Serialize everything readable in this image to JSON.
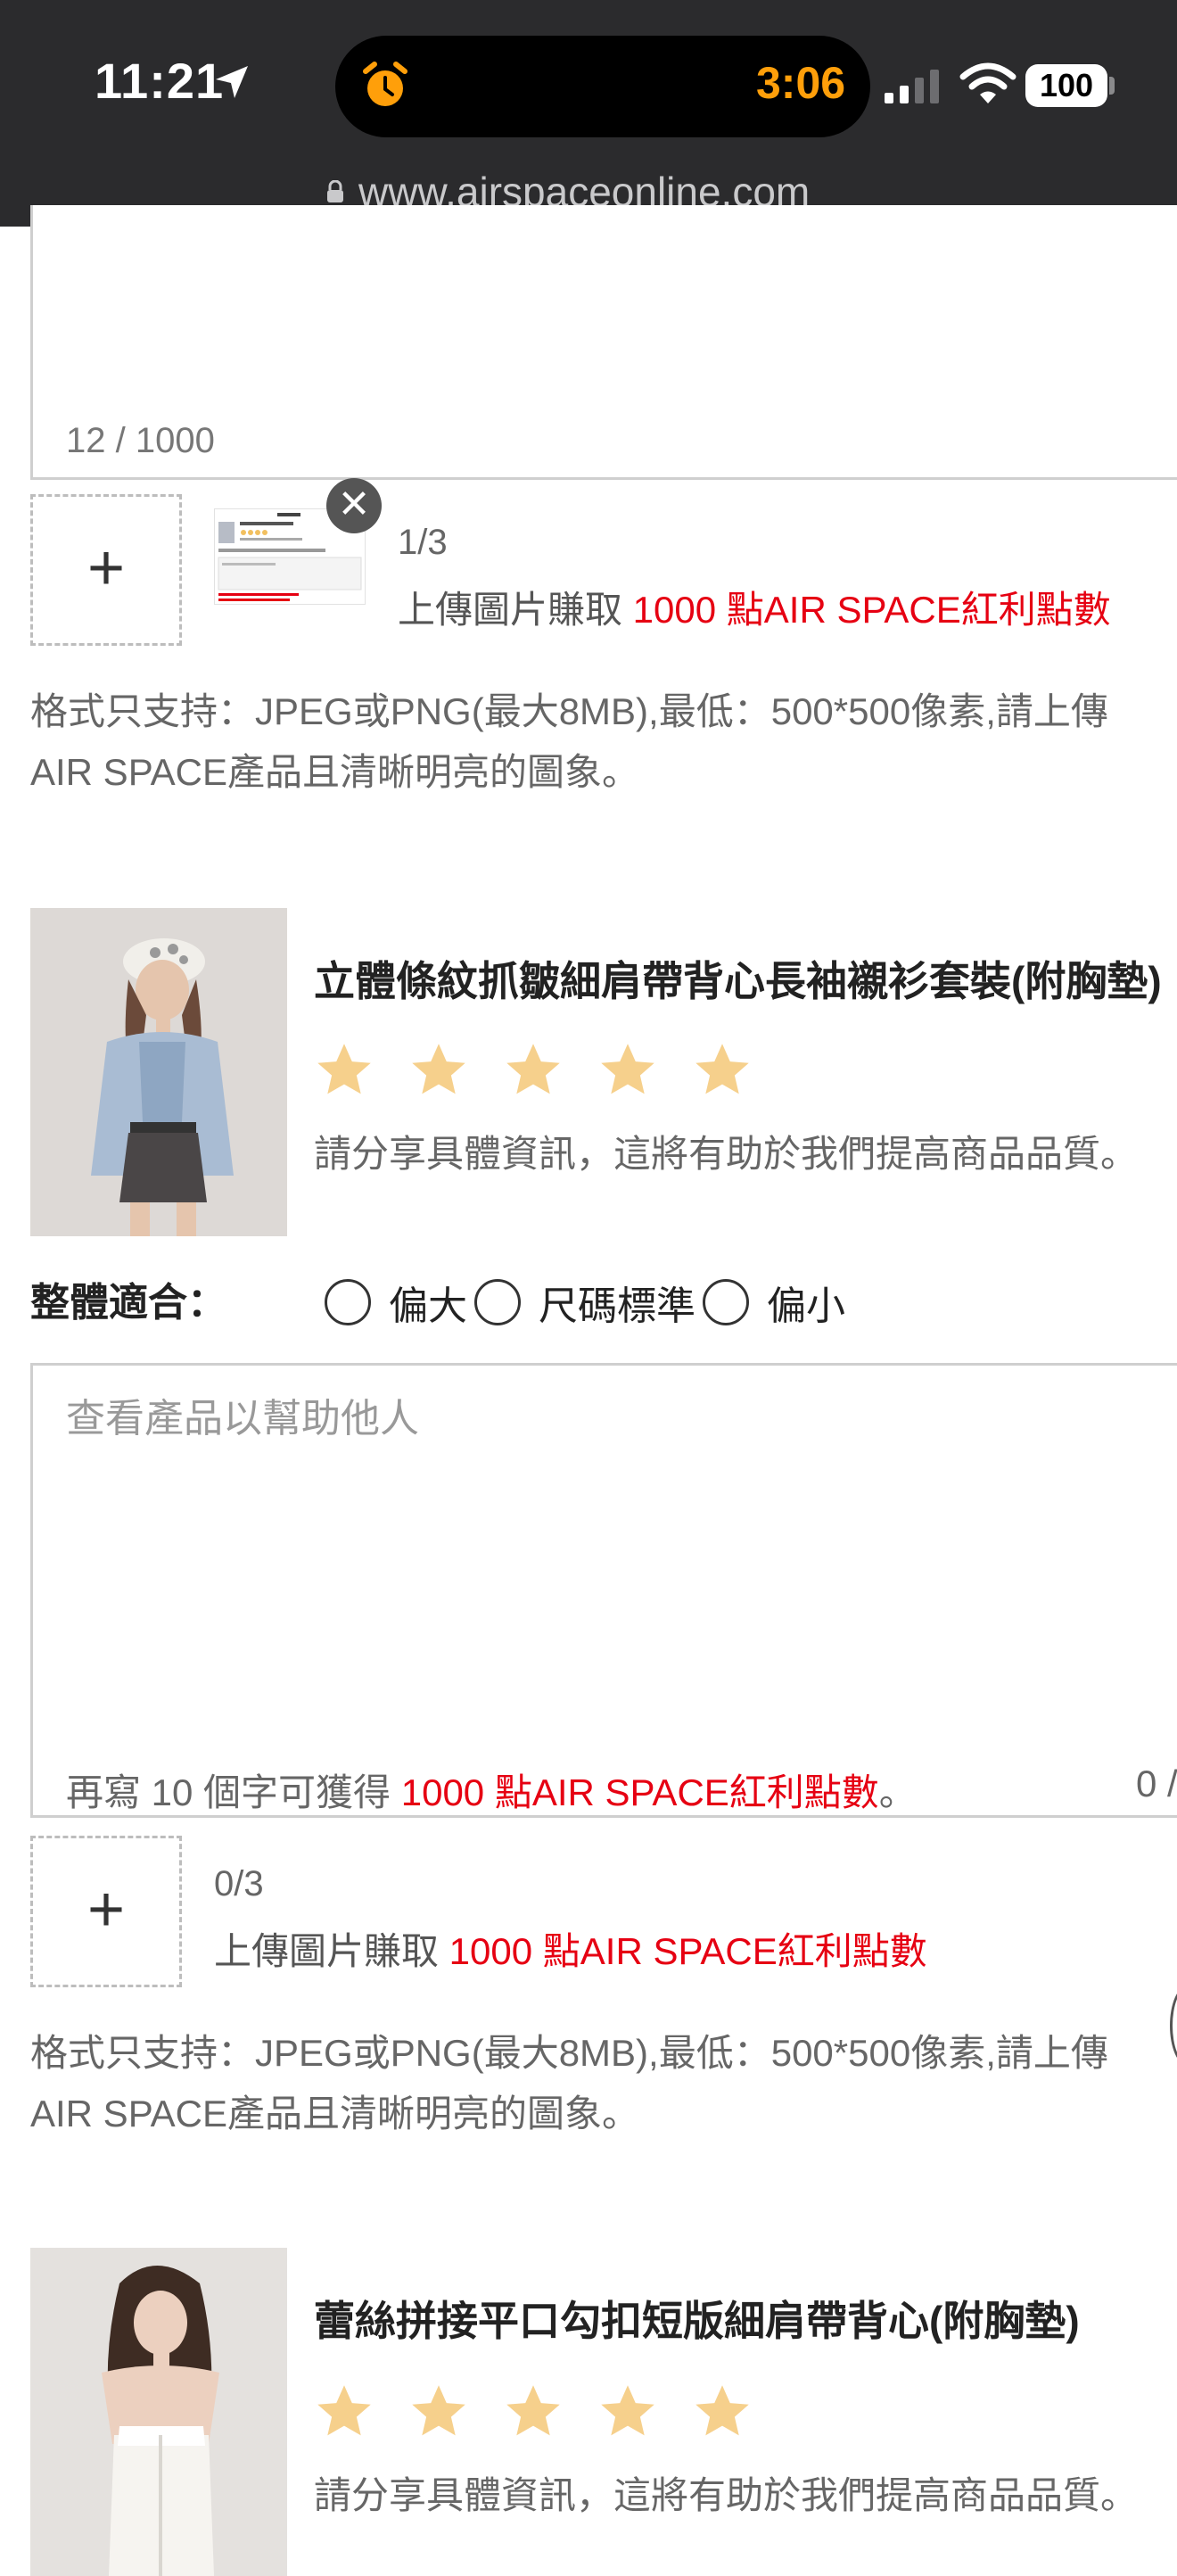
{
  "status_bar": {
    "time": "11:21",
    "timer": "3:06",
    "battery": "100",
    "url": "www.airspaceonline.com",
    "icons": [
      "location-arrow-icon",
      "alarm-clock-icon",
      "cellular-signal-icon",
      "wifi-icon",
      "lock-icon"
    ]
  },
  "review1": {
    "counter": "12 / 1000",
    "upload_count": "1/3",
    "upload_prefix": "上傳圖片賺取 ",
    "upload_bonus": "1000 點AIR SPACE紅利點數",
    "close_symbol": "✕",
    "format_line1": "格式只支持：JPEG或PNG(最大8MB),最低：500*500像素,請上傳",
    "format_line2": "AIR SPACE產品且清晰明亮的圖象。"
  },
  "product2": {
    "title": "立體條紋抓皺細肩帶背心長袖襯衫套裝(附胸墊)",
    "rating": 5,
    "hint": "請分享具體資訊，這將有助於我們提高商品品質。",
    "fit_label": "整體適合：",
    "fit_options": [
      "偏大",
      "尺碼標準",
      "偏小"
    ],
    "placeholder": "查看產品以幫助他人",
    "bonus_prefix": "再寫 10 個字可獲得 ",
    "bonus_highlight": "1000 點AIR SPACE紅利點數",
    "bonus_suffix": "。",
    "counter": "0 /",
    "upload_count": "0/3",
    "upload_prefix": "上傳圖片賺取 ",
    "upload_bonus": "1000 點AIR SPACE紅利點數",
    "format_line1": "格式只支持：JPEG或PNG(最大8MB),最低：500*500像素,請上傳",
    "format_line2": "AIR SPACE產品且清晰明亮的圖象。"
  },
  "product3": {
    "title": "蕾絲拼接平口勾扣短版細肩帶背心(附胸墊)",
    "rating": 5,
    "hint": "請分享具體資訊，這將有助於我們提高商品品質。"
  },
  "colors": {
    "accent_red": "#e60012",
    "star": "#f6d08c",
    "timer_orange": "#ff9f0a"
  }
}
